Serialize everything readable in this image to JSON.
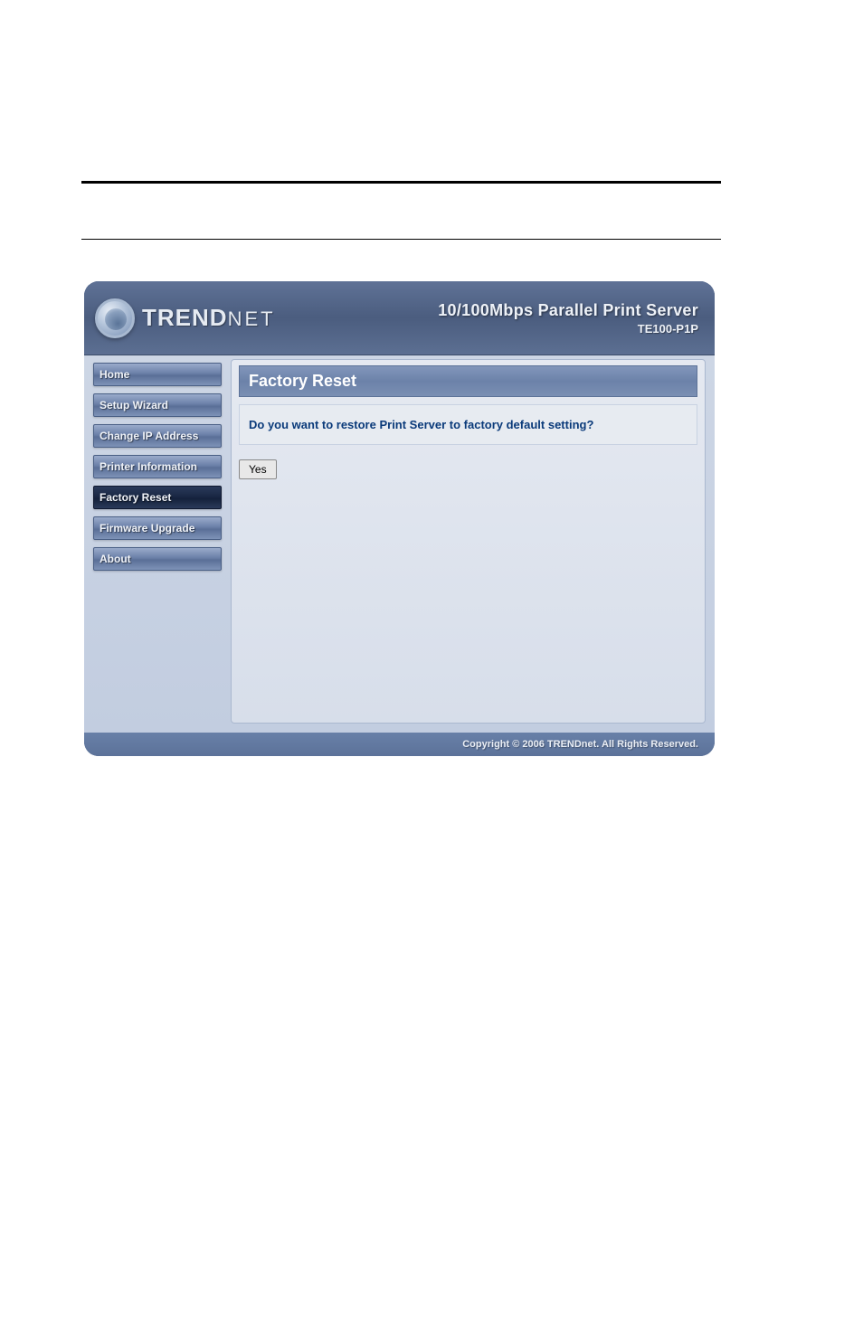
{
  "logo": {
    "brand_trend": "TREND",
    "brand_net": "NET"
  },
  "header": {
    "title": "10/100Mbps Parallel Print Server",
    "model": "TE100-P1P"
  },
  "sidebar": {
    "items": [
      {
        "label": "Home",
        "name": "nav-home",
        "active": false
      },
      {
        "label": "Setup Wizard",
        "name": "nav-setup-wizard",
        "active": false
      },
      {
        "label": "Change IP Address",
        "name": "nav-change-ip",
        "active": false
      },
      {
        "label": "Printer Information",
        "name": "nav-printer-info",
        "active": false
      },
      {
        "label": "Factory Reset",
        "name": "nav-factory-reset",
        "active": true
      },
      {
        "label": "Firmware Upgrade",
        "name": "nav-firmware-upgrade",
        "active": false
      },
      {
        "label": "About",
        "name": "nav-about",
        "active": false
      }
    ]
  },
  "content": {
    "title": "Factory Reset",
    "prompt": "Do you want to restore Print Server to factory default setting?",
    "yes_label": "Yes"
  },
  "footer": {
    "copyright": "Copyright © 2006 TRENDnet. All Rights Reserved."
  }
}
